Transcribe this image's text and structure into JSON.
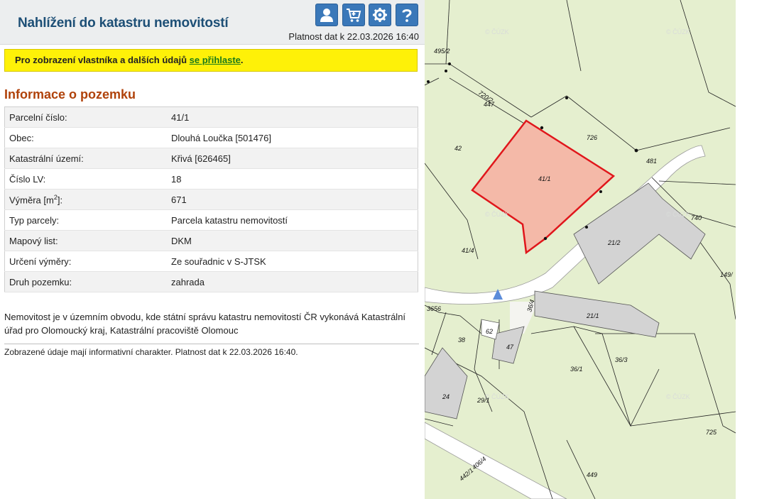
{
  "header": {
    "title": "Nahlížení do katastru nemovitostí",
    "validity": "Platnost dat k 22.03.2026 16:40",
    "buttons": {
      "user": "user-icon",
      "cart": "cart-icon",
      "settings": "gear-icon",
      "help": "help-icon"
    }
  },
  "login_banner": {
    "text_before": "Pro zobrazení vlastníka a dalších údajů ",
    "link": "se přihlaste",
    "text_after": "."
  },
  "section_title": "Informace o pozemku",
  "parcel": {
    "rows": [
      {
        "label": "Parcelní číslo:",
        "value": "41/1"
      },
      {
        "label": "Obec:",
        "value": "Dlouhá Loučka [501476]"
      },
      {
        "label": "Katastrální území:",
        "value": "Křivá [626465]"
      },
      {
        "label": "Číslo LV:",
        "value": "18"
      },
      {
        "label_main": "Výměra [m",
        "label_sup": "2",
        "label_end": "]:",
        "value": "671"
      },
      {
        "label": "Typ parcely:",
        "value": "Parcela katastru nemovitostí"
      },
      {
        "label": "Mapový list:",
        "value": "DKM"
      },
      {
        "label": "Určení výměry:",
        "value": "Ze souřadnic v S-JTSK"
      },
      {
        "label": "Druh pozemku:",
        "value": "zahrada"
      }
    ]
  },
  "note": "Nemovitost je v územním obvodu, kde státní správu katastru nemovitostí ČR vykonává Katastrální úřad pro Olomoucký kraj, Katastrální pracoviště Olomouc",
  "footer_note": "Zobrazené údaje mají informativní charakter. Platnost dat k 22.03.2026 16:40.",
  "map": {
    "watermark": "© ČÚZK",
    "colors": {
      "parcel_fill": "#f4b9a8",
      "parcel_stroke": "#e0161b",
      "land": "#e5efcf",
      "road": "#ffffff",
      "building": "#d3d3d3"
    },
    "labels": {
      "p495_2": "495/2",
      "p720_2": "720/2",
      "p447": "447",
      "p726": "726",
      "p42": "42",
      "p41_1": "41/1",
      "p481": "481",
      "p41_4": "41/4",
      "p21_2": "21/2",
      "p149": "149/",
      "p740": "740",
      "p3656": "3656",
      "p36_4": "36/4",
      "p21_1": "21/1",
      "p62": "62",
      "p38": "38",
      "p47": "47",
      "p36_1": "36/1",
      "p36_3": "36/3",
      "p24": "24",
      "p29_1": "29/1",
      "p725": "725",
      "p406_4": "406/4",
      "p442_1": "442/1",
      "p449": "449"
    }
  }
}
